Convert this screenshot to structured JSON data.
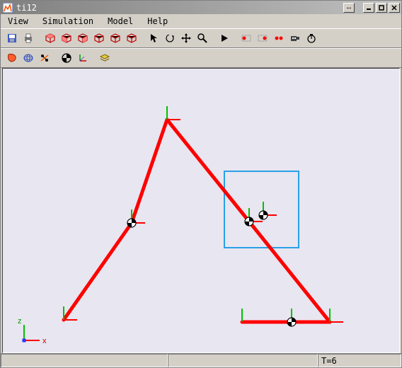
{
  "window": {
    "title": "ti12"
  },
  "menubar": {
    "items": [
      "View",
      "Simulation",
      "Model",
      "Help"
    ]
  },
  "status": {
    "time": "T=6"
  },
  "axes": {
    "xlabel": "x",
    "zlabel": "z"
  },
  "colors": {
    "accent_red": "#ff0000",
    "accent_green": "#00d000",
    "selection_blue": "#1e90ff",
    "canvas_bg": "#e8e6f0"
  },
  "toolbar1": {
    "save": "save",
    "print": "print",
    "cube_red_1": "iso-view-1",
    "cube_red_2": "iso-view-2",
    "cube_red_3": "iso-view-3",
    "cube_red_4": "iso-view-4",
    "cube_red_5": "iso-view-5",
    "cube_red_6": "iso-view-6",
    "arrow": "select",
    "rotate": "rotate",
    "pan": "pan",
    "zoom": "zoom",
    "play": "start-sim",
    "rec_back": "step-back",
    "rec_fwd": "record",
    "rc": "record-toggle",
    "camera": "camera",
    "clock": "timer"
  },
  "toolbar2": {
    "shade": "shaded",
    "wire": "wireframe",
    "joints": "show-joints",
    "com": "show-com",
    "frames": "show-frames",
    "layers": "layers"
  }
}
